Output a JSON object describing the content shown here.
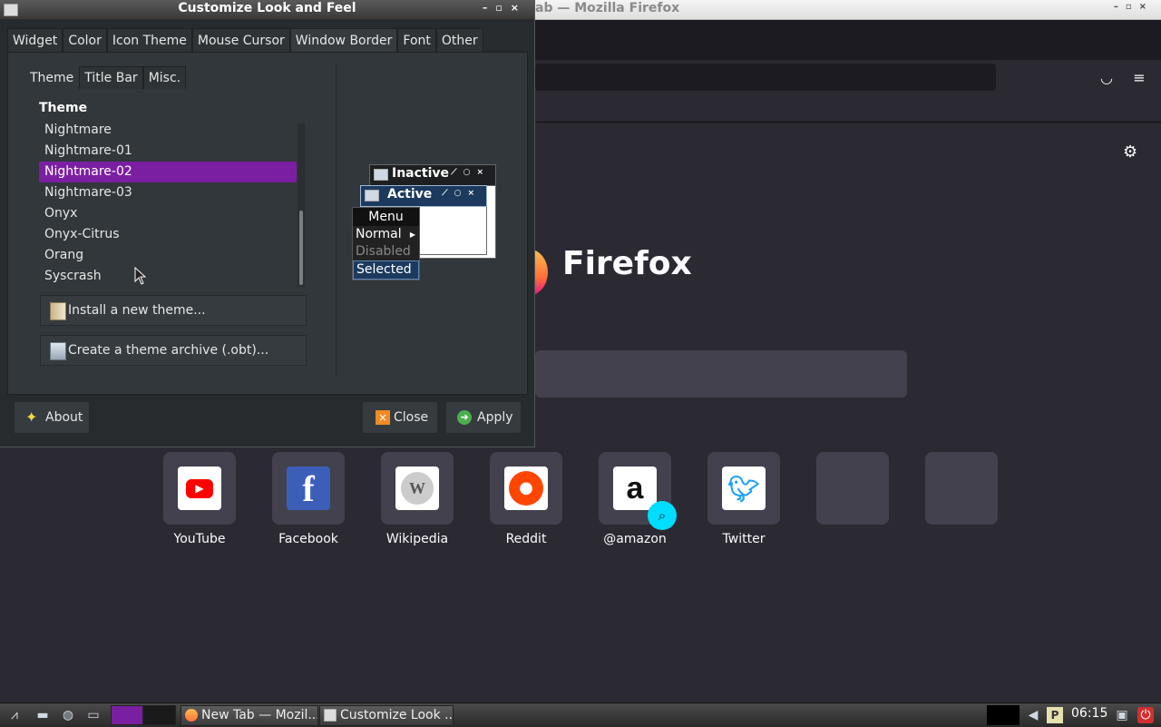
{
  "firefox": {
    "title": "New Tab — Mozilla Firefox",
    "visible_title": "ab — Mozilla Firefox",
    "wordmark": "Firefox",
    "sites": [
      {
        "label": "YouTube",
        "icon": "youtube-icon",
        "color": "#ff0000"
      },
      {
        "label": "Facebook",
        "icon": "facebook-icon",
        "color": "#1877f2"
      },
      {
        "label": "Wikipedia",
        "icon": "wikipedia-icon",
        "color": "#777777"
      },
      {
        "label": "Reddit",
        "icon": "reddit-icon",
        "color": "#ff4500"
      },
      {
        "label": "@amazon",
        "icon": "amazon-icon",
        "color": "#000000"
      },
      {
        "label": "Twitter",
        "icon": "twitter-icon",
        "color": "#1da1f2"
      }
    ]
  },
  "dialog": {
    "title": "Customize Look and Feel",
    "tabs": [
      "Widget",
      "Color",
      "Icon Theme",
      "Mouse Cursor",
      "Window Border",
      "Font",
      "Other"
    ],
    "active_tab": "Window Border",
    "subtabs": [
      "Theme",
      "Title Bar",
      "Misc."
    ],
    "active_subtab": "Theme",
    "theme_heading": "Theme",
    "themes": [
      "Nightmare",
      "Nightmare-01",
      "Nightmare-02",
      "Nightmare-03",
      "Onyx",
      "Onyx-Citrus",
      "Orang",
      "Syscrash"
    ],
    "selected_theme": "Nightmare-02",
    "install_label": "Install a new theme...",
    "archive_label": "Create a theme archive (.obt)...",
    "preview": {
      "inactive": "Inactive",
      "active": "Active",
      "menu_title": "Menu",
      "menu_items": [
        "Normal",
        "Disabled",
        "Selected"
      ]
    },
    "about_label": "About",
    "close_label": "Close",
    "apply_label": "Apply",
    "accent_color": "#7b1fa2"
  },
  "taskbar": {
    "tasks": [
      "New Tab — Mozil...",
      "Customize Look ..."
    ],
    "clock": "06:15"
  }
}
